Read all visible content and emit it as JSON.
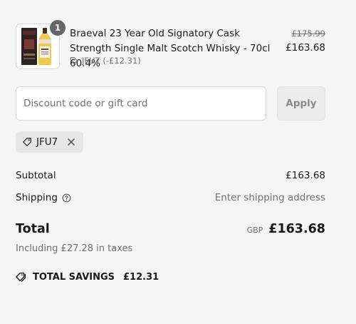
{
  "line_item": {
    "quantity": "1",
    "title": "Braeval 23 Year Old Signatory Cask Strength Single Malt Scotch Whisky - 70cl 60.4%",
    "discount_note": "JFU7 (-£12.31)",
    "price_original": "£175.99",
    "price_current": "£163.68"
  },
  "discount_form": {
    "placeholder": "Discount code or gift card",
    "value": "",
    "apply_label": "Apply"
  },
  "applied_code": {
    "code": "JFU7"
  },
  "totals": {
    "subtotal_label": "Subtotal",
    "subtotal_value": "£163.68",
    "shipping_label": "Shipping",
    "shipping_value": "Enter shipping address",
    "total_label": "Total",
    "currency": "GBP",
    "total_value": "£163.68",
    "taxes_note": "Including £27.28 in taxes",
    "savings_label": "TOTAL SAVINGS",
    "savings_value": "£12.31"
  },
  "icons": {
    "tag": "tag-icon",
    "remove": "close-icon",
    "info": "question-circle-icon",
    "savings": "tags-icon"
  },
  "colors": {
    "background": "#f5f5f5",
    "text": "#1a1a1a",
    "muted": "#707070",
    "badge": "#666666"
  }
}
